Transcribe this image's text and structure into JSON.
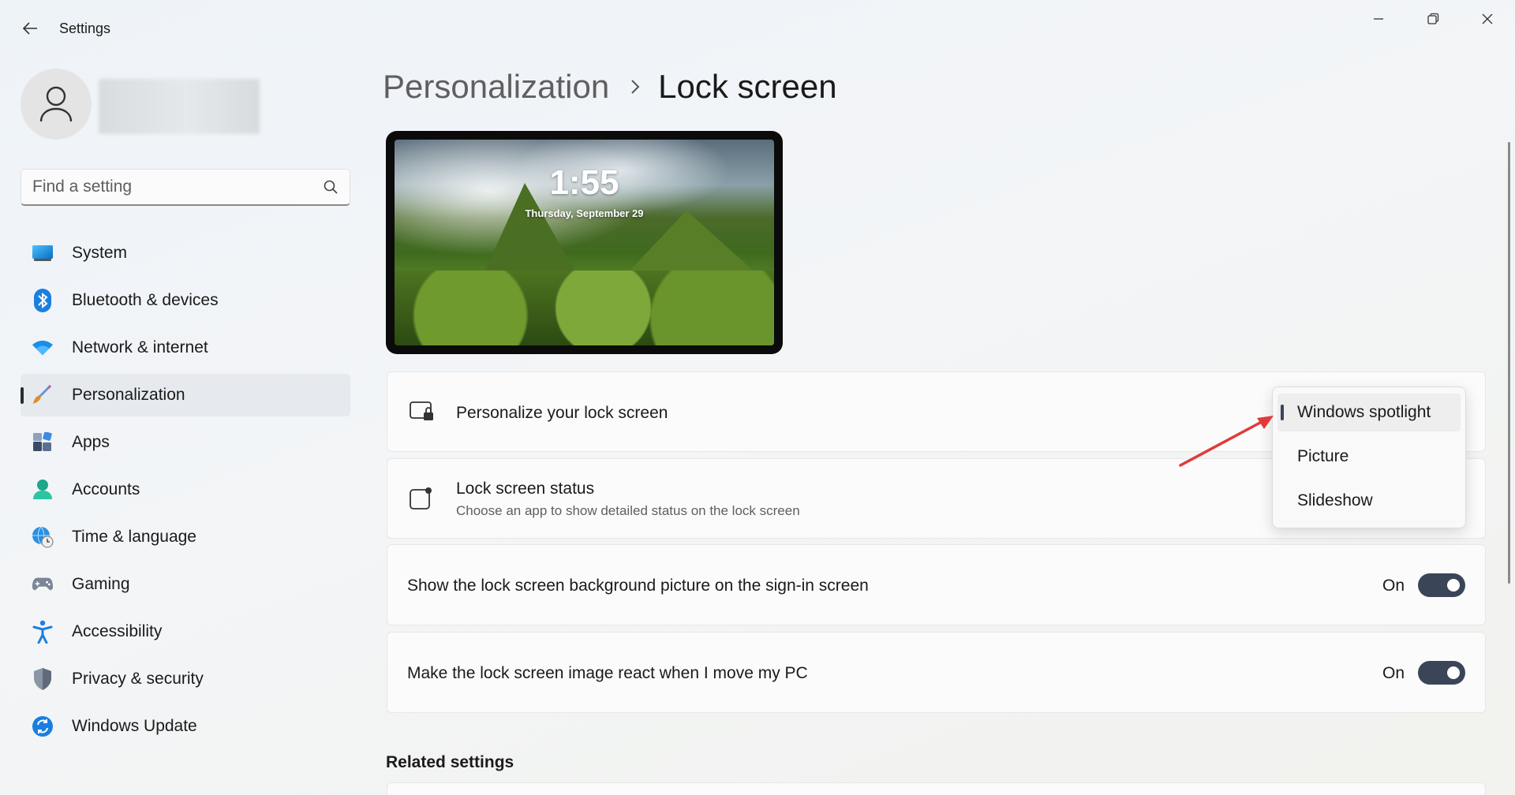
{
  "app": {
    "title": "Settings"
  },
  "search": {
    "placeholder": "Find a setting"
  },
  "sidebar": {
    "items": [
      {
        "label": "System"
      },
      {
        "label": "Bluetooth & devices"
      },
      {
        "label": "Network & internet"
      },
      {
        "label": "Personalization"
      },
      {
        "label": "Apps"
      },
      {
        "label": "Accounts"
      },
      {
        "label": "Time & language"
      },
      {
        "label": "Gaming"
      },
      {
        "label": "Accessibility"
      },
      {
        "label": "Privacy & security"
      },
      {
        "label": "Windows Update"
      }
    ],
    "active_index": 3
  },
  "breadcrumb": {
    "parent": "Personalization",
    "current": "Lock screen"
  },
  "preview": {
    "time": "1:55",
    "date": "Thursday, September 29"
  },
  "cards": {
    "personalize": {
      "title": "Personalize your lock screen"
    },
    "status": {
      "title": "Lock screen status",
      "subtitle": "Choose an app to show detailed status on the lock screen"
    },
    "background": {
      "label": "Show the lock screen background picture on the sign-in screen",
      "state": "On"
    },
    "react": {
      "label": "Make the lock screen image react when I move my PC",
      "state": "On"
    }
  },
  "dropdown": {
    "options": [
      "Windows spotlight",
      "Picture",
      "Slideshow"
    ],
    "selected": "Windows spotlight"
  },
  "related": {
    "title": "Related settings"
  },
  "colors": {
    "accent": "#3a4657",
    "annotation_arrow": "#e03a3a"
  }
}
